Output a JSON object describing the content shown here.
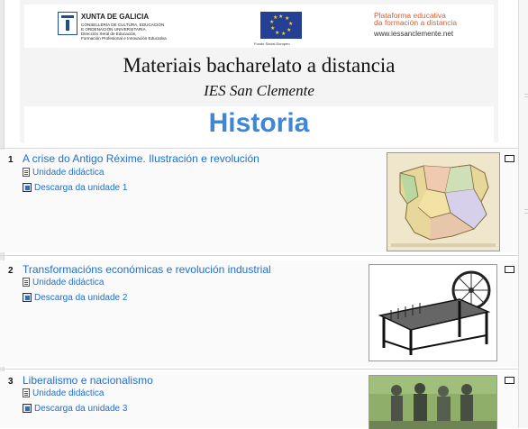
{
  "header": {
    "xunta_title": "XUNTA DE GALICIA",
    "xunta_lines": [
      "CONSELLERÍA DE CULTURA, EDUCACIÓN",
      "E ORDENACIÓN UNIVERSITARIA",
      "Dirección Xeral de Educación,",
      "Formación Profesional e Innovación Educativa"
    ],
    "eu_caption": "Fondo Social Europeo",
    "platform_line1": "Plataforma educativa",
    "platform_line2": "da formación a distancia",
    "platform_url": "www.iessanclemente.net",
    "main_title": "Materiais bacharelato a distancia",
    "school": "IES San Clemente",
    "subject": "Historia"
  },
  "sections": [
    {
      "number": "1",
      "title": "A crise do Antigo Réxime. Ilustración e revolución",
      "resources": [
        {
          "icon": "document-icon",
          "label": "Unidade didáctica"
        },
        {
          "icon": "download-icon",
          "label": "Descarga da unidade 1"
        }
      ],
      "image": "map-of-spain"
    },
    {
      "number": "2",
      "title": "Transformacións económicas e revolución industrial",
      "resources": [
        {
          "icon": "document-icon",
          "label": "Unidade didáctica"
        },
        {
          "icon": "download-icon",
          "label": "Descarga da unidade 2"
        }
      ],
      "image": "spinning-machine"
    },
    {
      "number": "3",
      "title": "Liberalismo e nacionalismo",
      "resources": [
        {
          "icon": "document-icon",
          "label": "Unidade didáctica"
        },
        {
          "icon": "download-icon",
          "label": "Descarga da unidade 3"
        }
      ],
      "image": "statue-group"
    }
  ]
}
